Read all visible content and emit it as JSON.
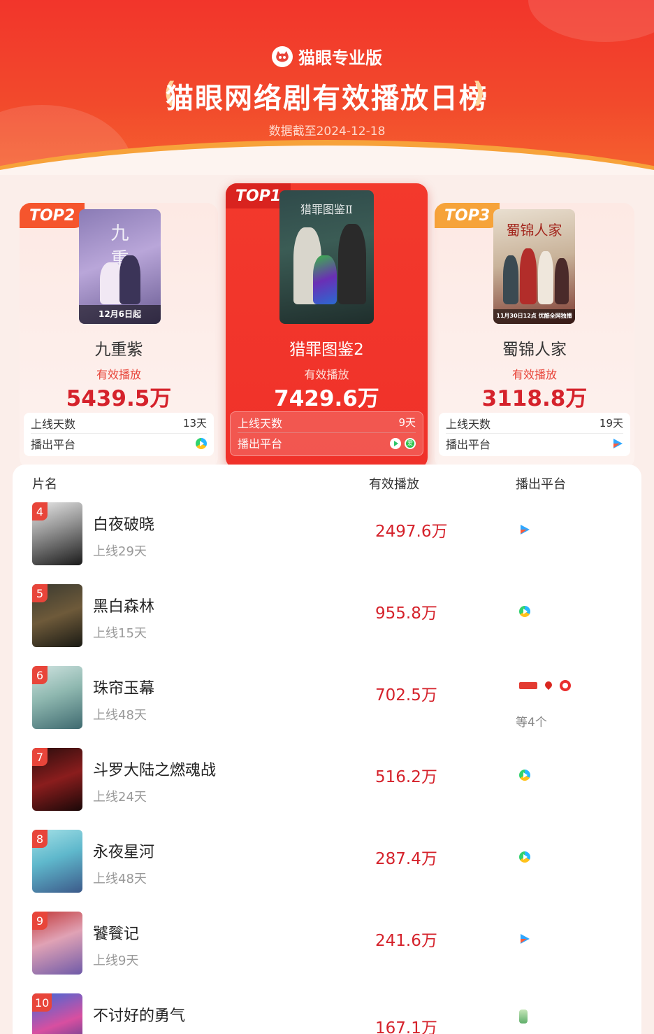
{
  "header": {
    "brand": "猫眼专业版",
    "title": "猫眼网络剧有效播放日榜",
    "date": "数据截至2024-12-18"
  },
  "podium": [
    {
      "rank_label": "TOP1",
      "title": "猎罪图鉴2",
      "label": "有效播放",
      "value": "7429.6万",
      "days_label": "上线天数",
      "days": "9天",
      "platform_label": "播出平台",
      "platforms": [
        "tencent-video-icon",
        "iqiyi-icon"
      ]
    },
    {
      "rank_label": "TOP2",
      "title": "九重紫",
      "label": "有效播放",
      "value": "5439.5万",
      "days_label": "上线天数",
      "days": "13天",
      "platform_label": "播出平台",
      "poster_caption": "12月6日起",
      "platforms": [
        "tencent-video-icon"
      ]
    },
    {
      "rank_label": "TOP3",
      "title": "蜀锦人家",
      "label": "有效播放",
      "value": "3118.8万",
      "days_label": "上线天数",
      "days": "19天",
      "platform_label": "播出平台",
      "poster_caption": "11月30日12点 优酷全网独播",
      "platforms": [
        "youku-icon"
      ]
    }
  ],
  "list": {
    "headers": {
      "name": "片名",
      "plays": "有效播放",
      "platform": "播出平台"
    },
    "rows": [
      {
        "rank": "4",
        "title": "白夜破晓",
        "days": "上线29天",
        "value": "2497.6万",
        "platform": "youku-icon"
      },
      {
        "rank": "5",
        "title": "黑白森林",
        "days": "上线15天",
        "value": "955.8万",
        "platform": "tencent-video-icon"
      },
      {
        "rank": "6",
        "title": "珠帘玉幕",
        "days": "上线48天",
        "value": "702.5万",
        "platform": "multi",
        "platform_more": "等4个"
      },
      {
        "rank": "7",
        "title": "斗罗大陆之燃魂战",
        "days": "上线24天",
        "value": "516.2万",
        "platform": "tencent-video-icon"
      },
      {
        "rank": "8",
        "title": "永夜星河",
        "days": "上线48天",
        "value": "287.4万",
        "platform": "tencent-video-icon"
      },
      {
        "rank": "9",
        "title": "饕餮记",
        "days": "上线9天",
        "value": "241.6万",
        "platform": "youku-icon"
      },
      {
        "rank": "10",
        "title": "不讨好的勇气",
        "days": "",
        "value": "167.1万",
        "platform": "other-icon"
      }
    ]
  },
  "colors": {
    "header_red": "#f2352b",
    "accent_red": "#d5222b",
    "top3_orange": "#f6a33a",
    "rank_badge": "#e8453a"
  }
}
